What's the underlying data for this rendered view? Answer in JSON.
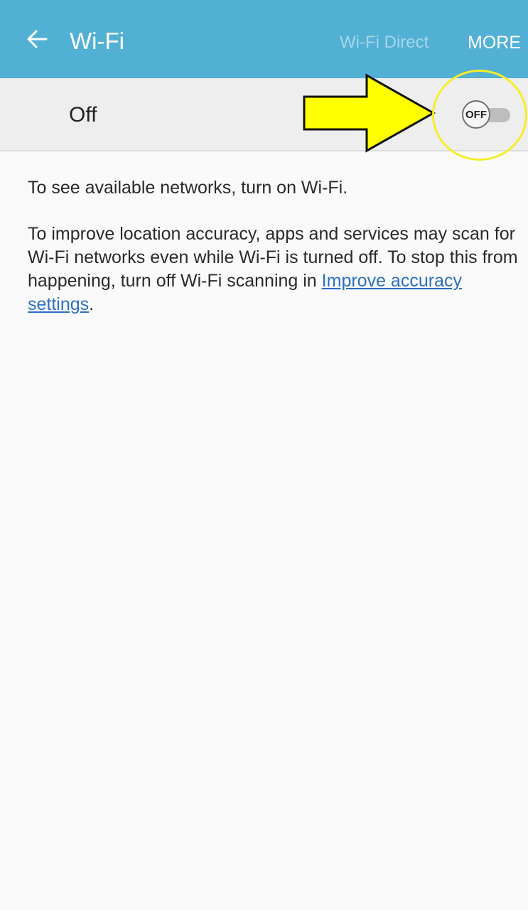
{
  "app_bar": {
    "title": "Wi-Fi",
    "wifi_direct_label": "Wi-Fi Direct",
    "more_label": "MORE",
    "color": "#53b0d5"
  },
  "switch_row": {
    "state_label": "Off",
    "toggle_label": "OFF"
  },
  "content": {
    "message": "To see available networks, turn on Wi-Fi.",
    "scanning_text": "To improve location accuracy, apps and services may scan for Wi-Fi networks even while Wi-Fi is turned off. To stop this from happening, turn off Wi-Fi scanning in ",
    "scanning_link": "Improve accuracy settings",
    "scanning_suffix": "."
  },
  "annotation": {
    "arrow_color": "#ffff00",
    "circle_color": "#f4ee2a"
  },
  "icons": {
    "back": "back-arrow-icon"
  }
}
